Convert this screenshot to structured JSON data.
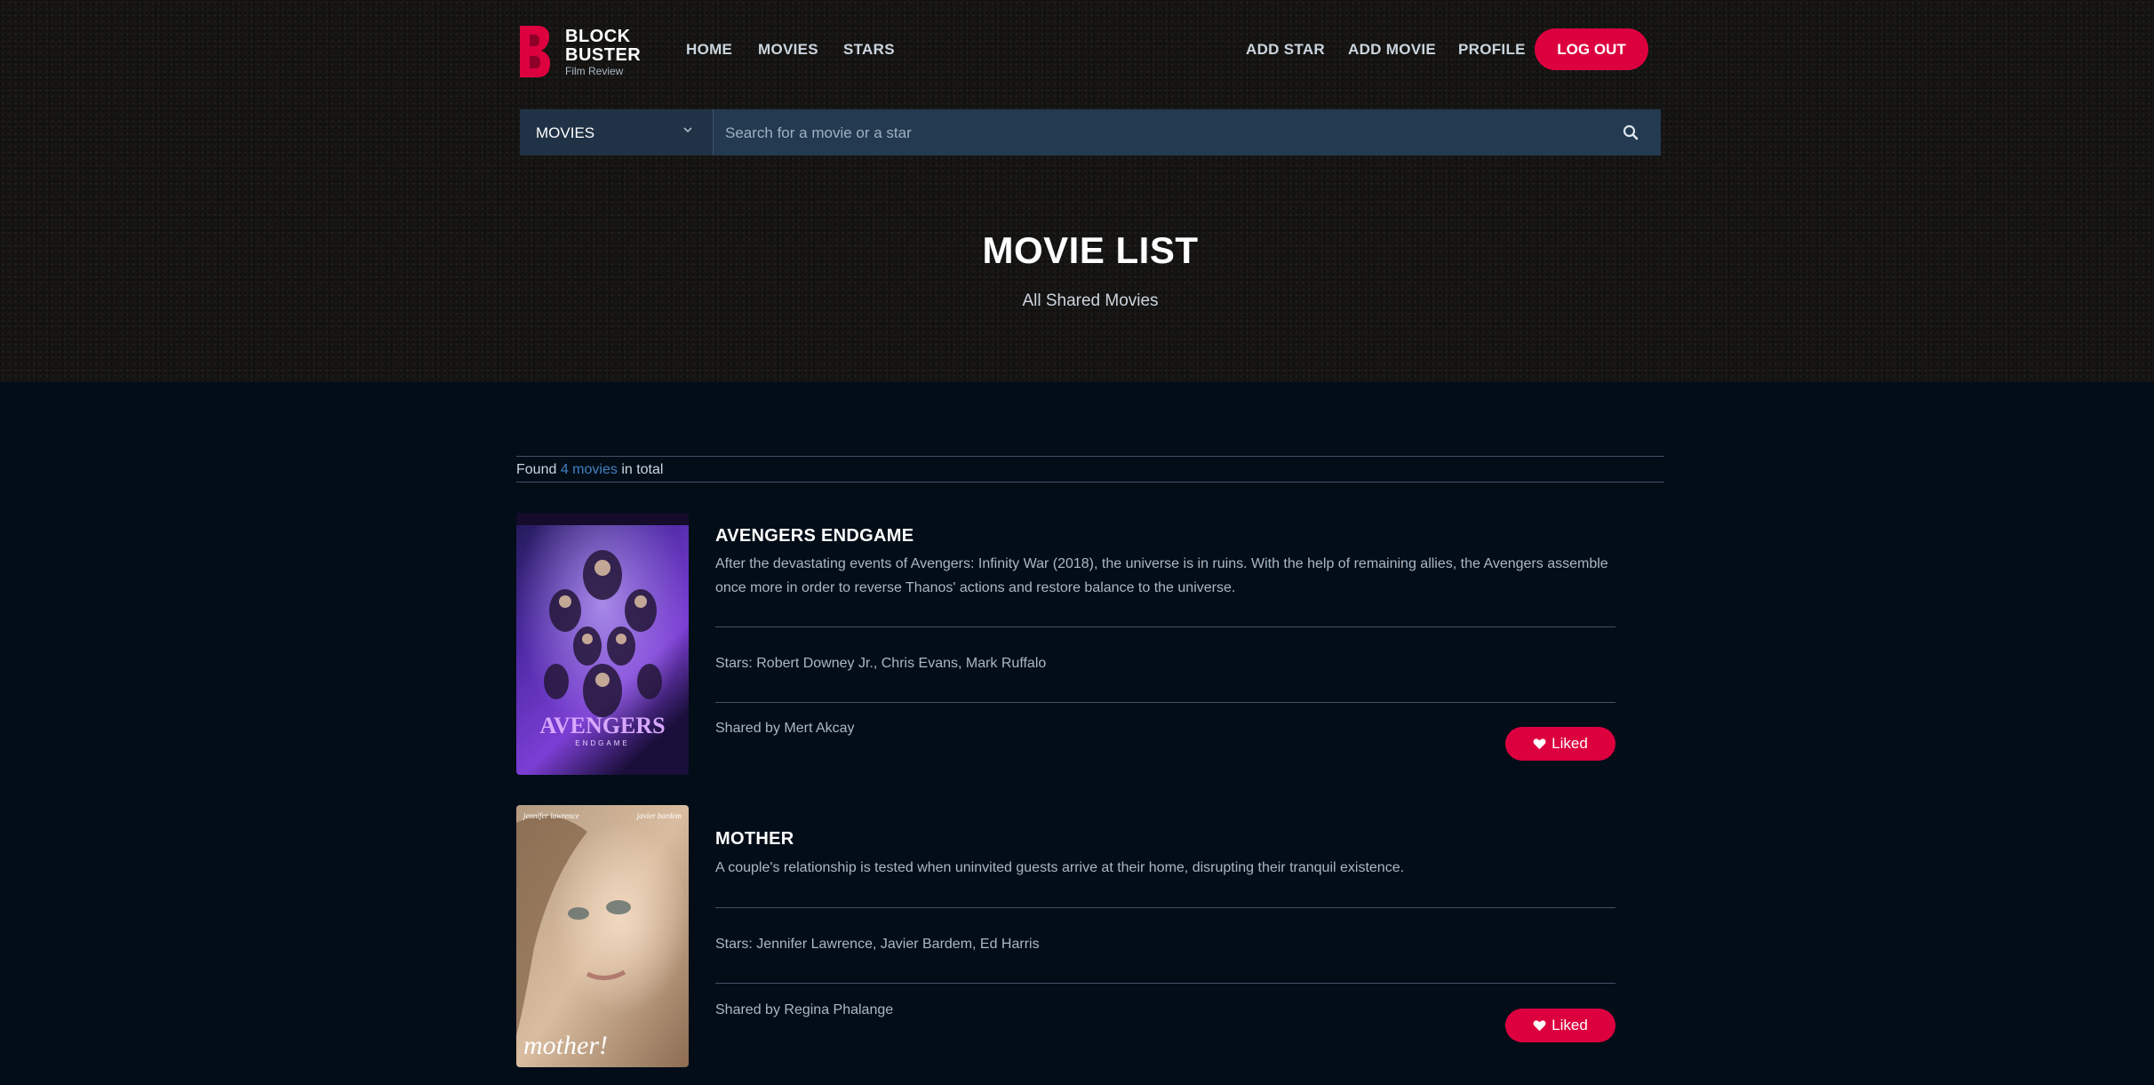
{
  "brand": {
    "line1": "BLOCK",
    "line2": "BUSTER",
    "tagline": "Film Review",
    "color": "#dd003f"
  },
  "nav": {
    "left": [
      {
        "label": "HOME"
      },
      {
        "label": "MOVIES"
      },
      {
        "label": "STARS"
      }
    ],
    "right": [
      {
        "label": "ADD STAR"
      },
      {
        "label": "ADD MOVIE"
      },
      {
        "label": "PROFILE"
      }
    ],
    "logout": "LOG OUT"
  },
  "search": {
    "category": "MOVIES",
    "placeholder": "Search for a movie or a star",
    "icon": "search-icon"
  },
  "hero": {
    "title": "MOVIE LIST",
    "subtitle": "All Shared Movies"
  },
  "results": {
    "prefix": "Found",
    "count": "4 movies",
    "suffix": "in total"
  },
  "movies": [
    {
      "title": "AVENGERS ENDGAME",
      "description": "After the devastating events of Avengers: Infinity War (2018), the universe is in ruins. With the help of remaining allies, the Avengers assemble once more in order to reverse Thanos' actions and restore balance to the universe.",
      "stars": "Stars: Robert Downey Jr., Chris Evans, Mark Ruffalo",
      "shared_by": "Shared by Mert Akcay",
      "like_label": "Liked",
      "poster": {
        "top_text": "",
        "title_text": "AVENGERS",
        "sub_text": "ENDGAME"
      }
    },
    {
      "title": "MOTHER",
      "description": "A couple's relationship is tested when uninvited guests arrive at their home, disrupting their tranquil existence.",
      "stars": "Stars: Jennifer Lawrence, Javier Bardem, Ed Harris",
      "shared_by": "Shared by Regina Phalange",
      "like_label": "Liked",
      "poster": {
        "top_left": "jennifer lawrence",
        "top_right": "javier bardem",
        "title_text": "mother!"
      }
    }
  ]
}
